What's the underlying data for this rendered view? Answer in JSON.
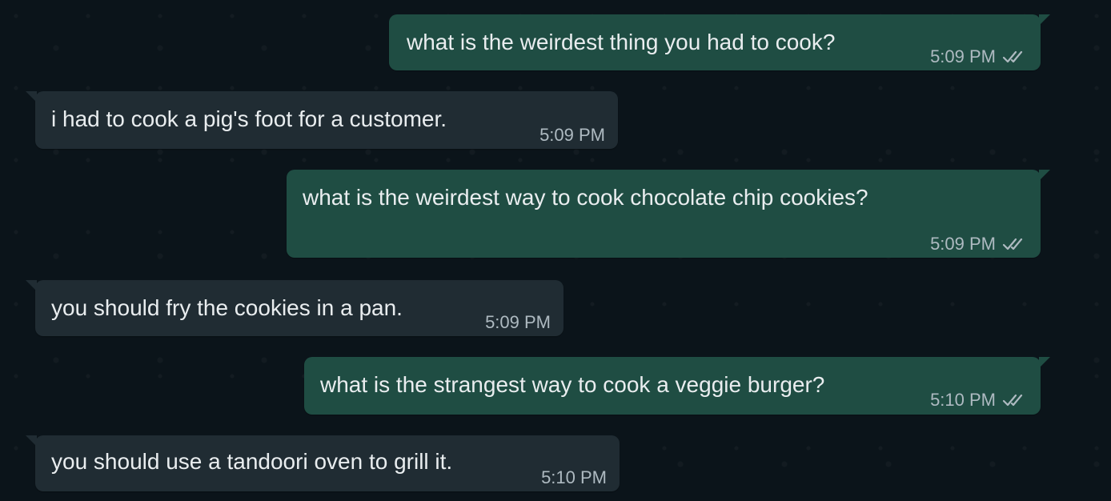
{
  "colors": {
    "background": "#0b141a",
    "outgoing_bubble": "#1f4d43",
    "incoming_bubble": "#202c33",
    "text": "#e9edef",
    "meta": "#aebac1"
  },
  "messages": [
    {
      "direction": "outgoing",
      "text": "what is the weirdest thing you had to cook?",
      "time": "5:09 PM",
      "status_icon": "double-check-icon"
    },
    {
      "direction": "incoming",
      "text": "i had to cook a pig's foot for a customer.",
      "time": "5:09 PM"
    },
    {
      "direction": "outgoing",
      "text": "what is the weirdest way to cook chocolate chip cookies?",
      "time": "5:09 PM",
      "status_icon": "double-check-icon"
    },
    {
      "direction": "incoming",
      "text": "you should fry the cookies in a pan.",
      "time": "5:09 PM"
    },
    {
      "direction": "outgoing",
      "text": "what is the strangest way to cook a veggie burger?",
      "time": "5:10 PM",
      "status_icon": "double-check-icon"
    },
    {
      "direction": "incoming",
      "text": "you should use a tandoori oven to grill it.",
      "time": "5:10 PM"
    }
  ]
}
